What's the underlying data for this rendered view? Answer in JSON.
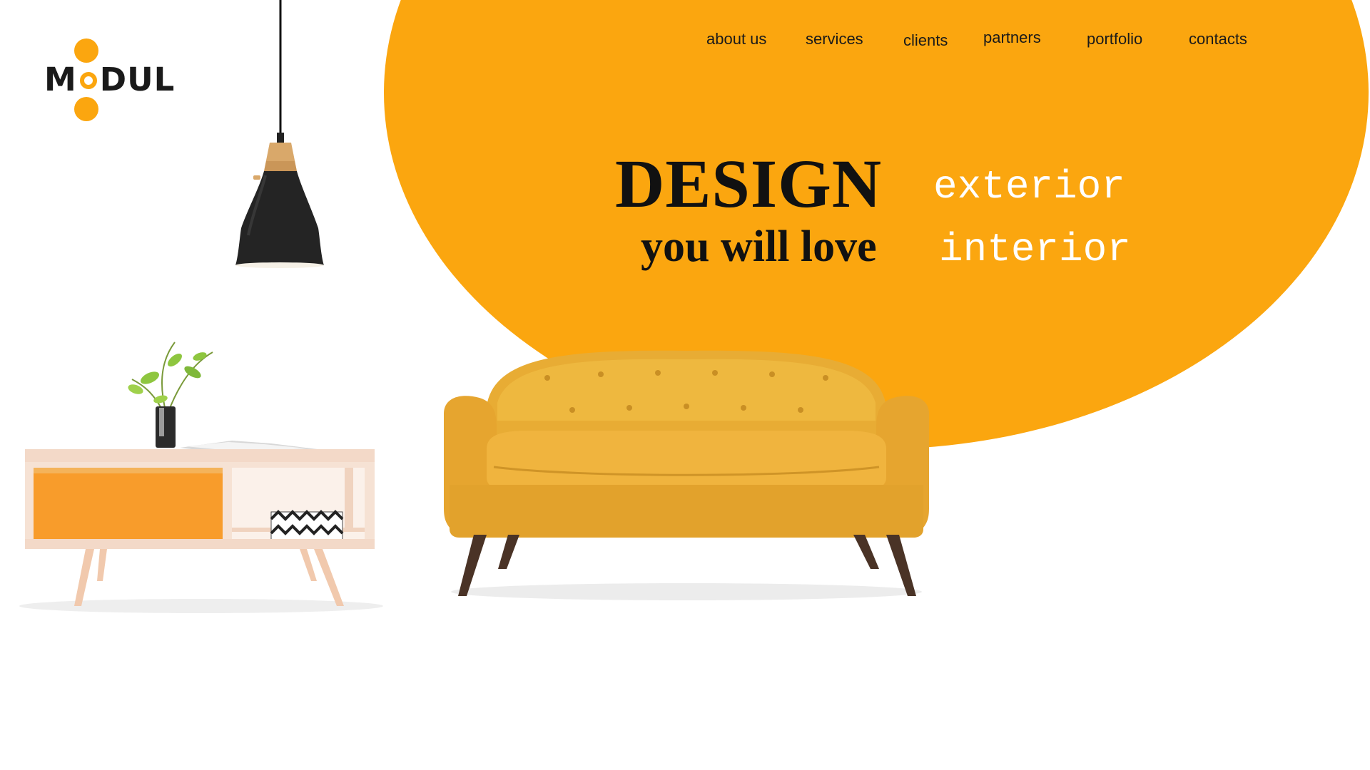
{
  "brand": {
    "name": "MODUL",
    "name_parts": [
      "M",
      "DUL"
    ],
    "accent_color": "#fba60f",
    "text_color": "#1a1a1a"
  },
  "nav": {
    "items": [
      {
        "label": "about us"
      },
      {
        "label": "services"
      },
      {
        "label": "clients"
      },
      {
        "label": "partners"
      },
      {
        "label": "portfolio"
      },
      {
        "label": "contacts"
      }
    ]
  },
  "hero": {
    "headline": "DESIGN",
    "subheadline": "you will love",
    "word_1": "exterior",
    "word_2": "interior"
  },
  "images": {
    "lamp": "pendant-lamp",
    "side_table": "side-table-with-plant-and-magazine",
    "sofa": "yellow-sofa"
  }
}
